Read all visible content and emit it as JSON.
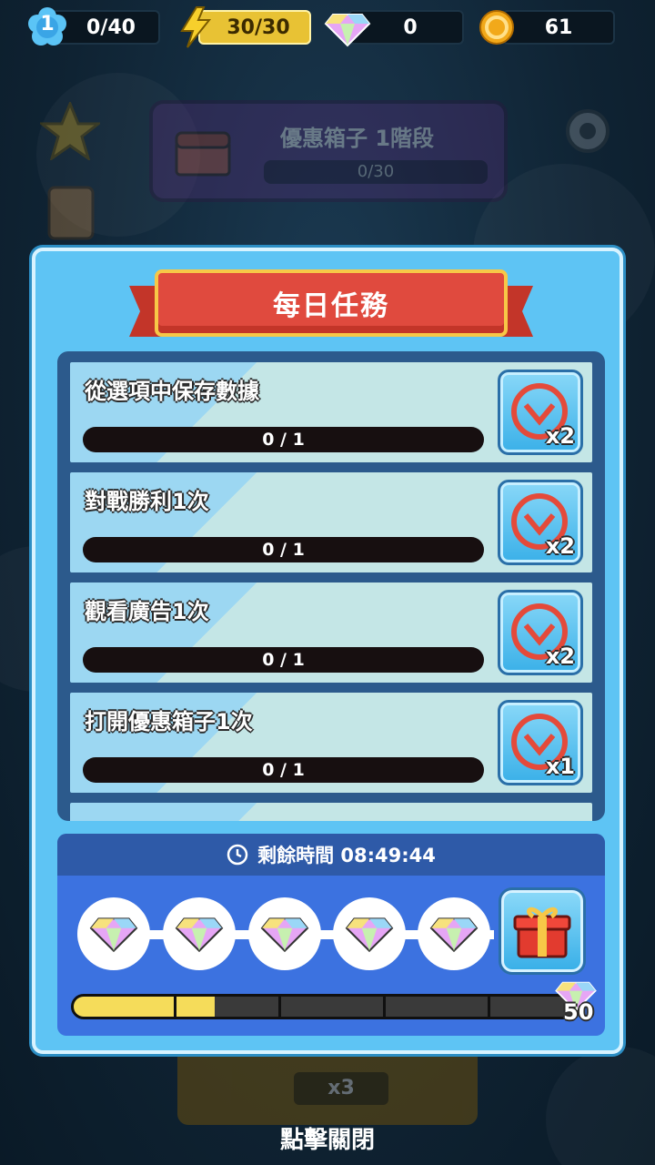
{
  "hud": {
    "level": "1",
    "level_progress": "0/40",
    "energy": "30/30",
    "gems": "0",
    "coins": "61"
  },
  "promo": {
    "title": "優惠箱子 1階段",
    "progress": "0/30"
  },
  "panel": {
    "title": "每日任務",
    "tasks": [
      {
        "title": "從選項中保存數據",
        "progress": "0 / 1",
        "reward": "x2"
      },
      {
        "title": "對戰勝利1次",
        "progress": "0 / 1",
        "reward": "x2"
      },
      {
        "title": "觀看廣告1次",
        "progress": "0 / 1",
        "reward": "x2"
      },
      {
        "title": "打開優惠箱子1次",
        "progress": "0 / 1",
        "reward": "x1"
      }
    ],
    "timer_label": "剩餘時間 08:49:44",
    "milestone_goal": "50",
    "milestone_fraction": 0.28
  },
  "background_button": {
    "multiplier": "x3"
  },
  "close_hint": "點擊關閉",
  "colors": {
    "panel": "#5ec4f4",
    "ribbon": "#e04a3e",
    "progress_fill": "#f5dc5a"
  }
}
